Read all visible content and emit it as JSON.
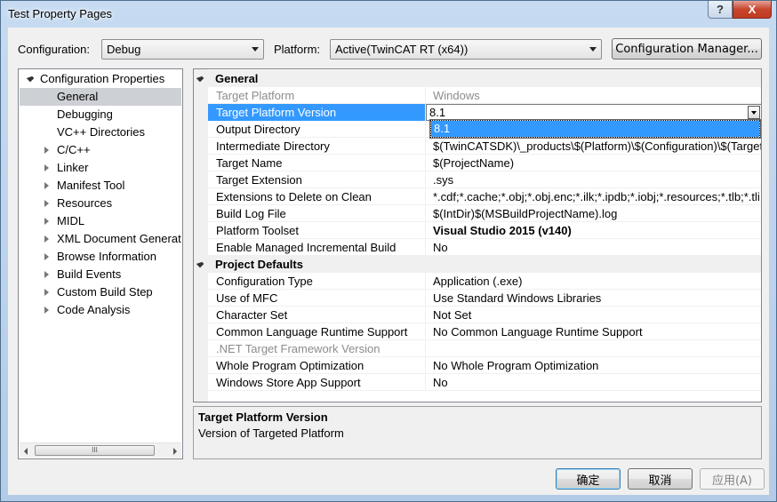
{
  "window": {
    "title": "Test Property Pages"
  },
  "toolbar": {
    "configuration_label": "Configuration:",
    "configuration_value": "Debug",
    "platform_label": "Platform:",
    "platform_value": "Active(TwinCAT RT (x64))",
    "config_manager_label": "Configuration Manager..."
  },
  "tree": {
    "root": "Configuration Properties",
    "items": [
      {
        "label": "General",
        "selected": true,
        "expandable": false
      },
      {
        "label": "Debugging",
        "expandable": false
      },
      {
        "label": "VC++ Directories",
        "expandable": false
      },
      {
        "label": "C/C++",
        "expandable": true
      },
      {
        "label": "Linker",
        "expandable": true
      },
      {
        "label": "Manifest Tool",
        "expandable": true
      },
      {
        "label": "Resources",
        "expandable": true
      },
      {
        "label": "MIDL",
        "expandable": true
      },
      {
        "label": "XML Document Generat",
        "expandable": true
      },
      {
        "label": "Browse Information",
        "expandable": true
      },
      {
        "label": "Build Events",
        "expandable": true
      },
      {
        "label": "Custom Build Step",
        "expandable": true
      },
      {
        "label": "Code Analysis",
        "expandable": true
      }
    ],
    "scroll_grip": "III"
  },
  "grid": {
    "general_label": "General",
    "general": [
      {
        "name": "Target Platform",
        "value": "Windows",
        "grey": true
      },
      {
        "name": "Target Platform Version",
        "value": "8.1",
        "selected": true
      },
      {
        "name": "Output Directory",
        "value": ""
      },
      {
        "name": "Intermediate Directory",
        "value": "$(TwinCATSDK)\\_products\\$(Platform)\\$(Configuration)\\$(TargetName)\\"
      },
      {
        "name": "Target Name",
        "value": "$(ProjectName)"
      },
      {
        "name": "Target Extension",
        "value": ".sys"
      },
      {
        "name": "Extensions to Delete on Clean",
        "value": "*.cdf;*.cache;*.obj;*.obj.enc;*.ilk;*.ipdb;*.iobj;*.resources;*.tlb;*.tli;*.tlh"
      },
      {
        "name": "Build Log File",
        "value": "$(IntDir)$(MSBuildProjectName).log"
      },
      {
        "name": "Platform Toolset",
        "value": "Visual Studio 2015 (v140)",
        "bold": true
      },
      {
        "name": "Enable Managed Incremental Build",
        "value": "No"
      }
    ],
    "defaults_label": "Project Defaults",
    "defaults": [
      {
        "name": "Configuration Type",
        "value": "Application (.exe)"
      },
      {
        "name": "Use of MFC",
        "value": "Use Standard Windows Libraries"
      },
      {
        "name": "Character Set",
        "value": "Not Set"
      },
      {
        "name": "Common Language Runtime Support",
        "value": "No Common Language Runtime Support"
      },
      {
        "name": ".NET Target Framework Version",
        "value": "",
        "grey": true
      },
      {
        "name": "Whole Program Optimization",
        "value": "No Whole Program Optimization"
      },
      {
        "name": "Windows Store App Support",
        "value": "No"
      }
    ],
    "dropdown_option": "8.1"
  },
  "description": {
    "title": "Target Platform Version",
    "text": "Version of Targeted Platform"
  },
  "buttons": {
    "ok": "确定",
    "cancel": "取消",
    "apply": "应用(A)"
  },
  "title_buttons": {
    "help": "?",
    "close": "X"
  }
}
